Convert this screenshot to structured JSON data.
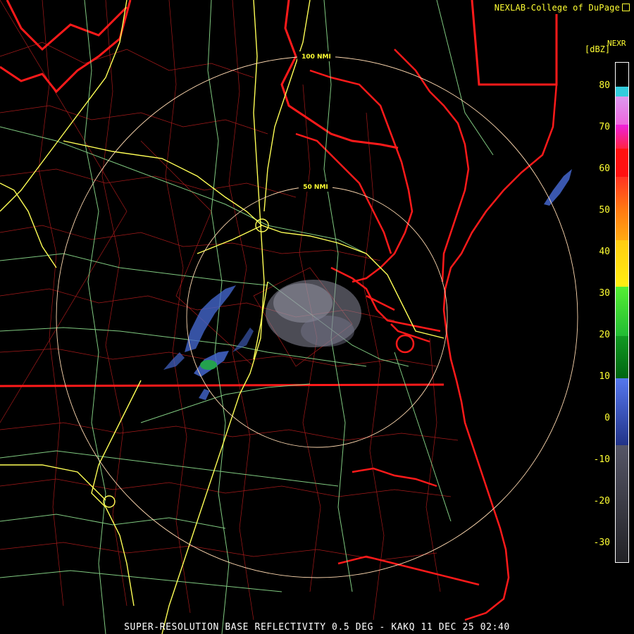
{
  "credit": "NEXLAB-College of DuPage",
  "product_title": "SUPER-RESOLUTION BASE REFLECTIVITY 0.5 DEG - KAKQ 11 DEC 25 02:40",
  "legend": {
    "title": "NEXR",
    "unit": "[dBZ]",
    "ticks": [
      "80",
      "70",
      "60",
      "50",
      "40",
      "30",
      "20",
      "10",
      "0",
      "-10",
      "-20",
      "-30"
    ]
  },
  "range_rings": [
    {
      "label": "50 NMI"
    },
    {
      "label": "100 NMI"
    }
  ],
  "colors": {
    "state_border": "#ff1a1a",
    "county_border": "#cc2222",
    "highway_major": "#ffff55",
    "highway_minor": "#99ee99",
    "ring": "#ffd9b0",
    "echo_light": "#4466cc",
    "echo_clutter": "#8a8a9a",
    "echo_green": "#22aa44"
  }
}
